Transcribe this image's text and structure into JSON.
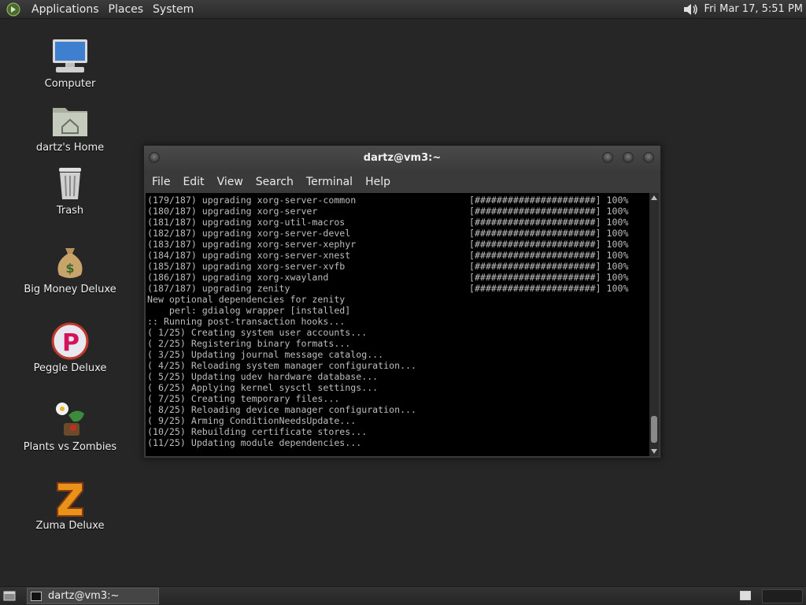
{
  "top_panel": {
    "menus": [
      "Applications",
      "Places",
      "System"
    ],
    "clock": "Fri Mar 17,  5:51 PM"
  },
  "desktop_icons": [
    {
      "label": "Computer"
    },
    {
      "label": "dartz's Home"
    },
    {
      "label": "Trash"
    },
    {
      "label": "Big Money Deluxe"
    },
    {
      "label": "Peggle Deluxe"
    },
    {
      "label": "Plants vs Zombies"
    },
    {
      "label": "Zuma Deluxe"
    }
  ],
  "terminal": {
    "title": "dartz@vm3:~",
    "menu": [
      "File",
      "Edit",
      "View",
      "Search",
      "Terminal",
      "Help"
    ],
    "progress_lines": [
      {
        "text": "(179/187) upgrading xorg-server-common",
        "bar": "[######################] 100%"
      },
      {
        "text": "(180/187) upgrading xorg-server",
        "bar": "[######################] 100%"
      },
      {
        "text": "(181/187) upgrading xorg-util-macros",
        "bar": "[######################] 100%"
      },
      {
        "text": "(182/187) upgrading xorg-server-devel",
        "bar": "[######################] 100%"
      },
      {
        "text": "(183/187) upgrading xorg-server-xephyr",
        "bar": "[######################] 100%"
      },
      {
        "text": "(184/187) upgrading xorg-server-xnest",
        "bar": "[######################] 100%"
      },
      {
        "text": "(185/187) upgrading xorg-server-xvfb",
        "bar": "[######################] 100%"
      },
      {
        "text": "(186/187) upgrading xorg-xwayland",
        "bar": "[######################] 100%"
      },
      {
        "text": "(187/187) upgrading zenity",
        "bar": "[######################] 100%"
      }
    ],
    "lines": [
      "New optional dependencies for zenity",
      "    perl: gdialog wrapper [installed]",
      ":: Running post-transaction hooks...",
      "( 1/25) Creating system user accounts...",
      "( 2/25) Registering binary formats...",
      "( 3/25) Updating journal message catalog...",
      "( 4/25) Reloading system manager configuration...",
      "( 5/25) Updating udev hardware database...",
      "( 6/25) Applying kernel sysctl settings...",
      "( 7/25) Creating temporary files...",
      "( 8/25) Reloading device manager configuration...",
      "( 9/25) Arming ConditionNeedsUpdate...",
      "(10/25) Rebuilding certificate stores...",
      "(11/25) Updating module dependencies..."
    ]
  },
  "bottom_panel": {
    "taskbar_items": [
      {
        "label": "dartz@vm3:~"
      }
    ]
  },
  "colors": {
    "desktop_bg": "#262626",
    "panel_bg": "#2f2f2f",
    "terminal_bg": "#000000",
    "terminal_fg": "#bdbdbd"
  }
}
